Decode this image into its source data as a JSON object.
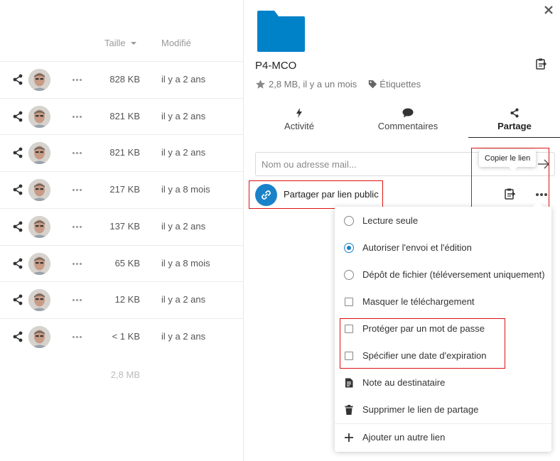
{
  "file_list": {
    "header": {
      "size_label": "Taille",
      "modified_label": "Modifié"
    },
    "rows": [
      {
        "size": "828 KB",
        "modified": "il y a 2 ans"
      },
      {
        "size": "821 KB",
        "modified": "il y a 2 ans"
      },
      {
        "size": "821 KB",
        "modified": "il y a 2 ans"
      },
      {
        "size": "217 KB",
        "modified": "il y a 8 mois"
      },
      {
        "size": "137 KB",
        "modified": "il y a 2 ans"
      },
      {
        "size": "65 KB",
        "modified": "il y a 8 mois"
      },
      {
        "size": "12 KB",
        "modified": "il y a 2 ans"
      },
      {
        "size": "< 1 KB",
        "modified": "il y a 2 ans"
      }
    ],
    "total_size": "2,8 MB"
  },
  "sidebar": {
    "title": "P4-MCO",
    "meta": "2,8 MB, il y a un mois",
    "tags_label": "Étiquettes",
    "tabs": [
      {
        "label": "Activité",
        "icon": "bolt-icon"
      },
      {
        "label": "Commentaires",
        "icon": "comment-icon"
      },
      {
        "label": "Partage",
        "icon": "share-icon"
      }
    ],
    "active_tab": "Partage",
    "share_input_placeholder": "Nom ou adresse mail...",
    "tooltip": "Copier le lien",
    "public_link_label": "Partager par lien public"
  },
  "menu": {
    "items": [
      {
        "label": "Lecture seule",
        "control": "radio",
        "checked": false
      },
      {
        "label": "Autoriser l'envoi et l'édition",
        "control": "radio",
        "checked": true
      },
      {
        "label": "Dépôt de fichier (téléversement uniquement)",
        "control": "radio",
        "checked": false
      },
      {
        "label": "Masquer le téléchargement",
        "control": "checkbox",
        "checked": false
      },
      {
        "label": "Protéger par un mot de passe",
        "control": "checkbox",
        "checked": false
      },
      {
        "label": "Spécifier une date d'expiration",
        "control": "checkbox",
        "checked": false
      },
      {
        "label": "Note au destinataire",
        "control": "note-icon"
      },
      {
        "label": "Supprimer le lien de partage",
        "control": "trash-icon"
      },
      {
        "label": "Ajouter un autre lien",
        "control": "plus-icon"
      }
    ]
  },
  "colors": {
    "accent": "#1a82c8",
    "highlight": "#dd1111"
  }
}
